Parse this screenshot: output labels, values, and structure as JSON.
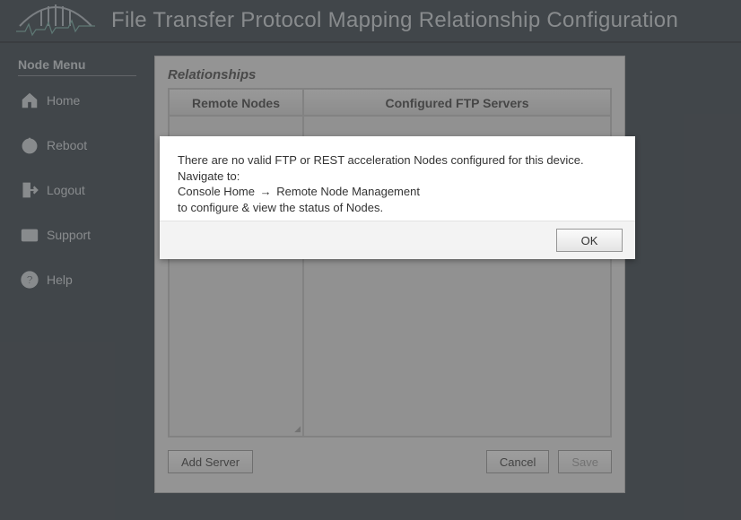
{
  "header": {
    "title": "File Transfer Protocol Mapping Relationship Configuration"
  },
  "sidebar": {
    "title": "Node Menu",
    "items": [
      {
        "label": "Home"
      },
      {
        "label": "Reboot"
      },
      {
        "label": "Logout"
      },
      {
        "label": "Support"
      },
      {
        "label": "Help"
      }
    ]
  },
  "panel": {
    "title": "Relationships",
    "columns": {
      "remote": "Remote Nodes",
      "servers": "Configured FTP Servers"
    },
    "buttons": {
      "add": "Add Server",
      "cancel": "Cancel",
      "save": "Save"
    }
  },
  "dialog": {
    "line1": "There are no valid FTP or REST acceleration Nodes configured for this device. Navigate to:",
    "path_a": "Console Home",
    "arrow": "→",
    "path_b": "Remote Node Management",
    "line3": "to configure & view the status of Nodes.",
    "ok": "OK"
  }
}
